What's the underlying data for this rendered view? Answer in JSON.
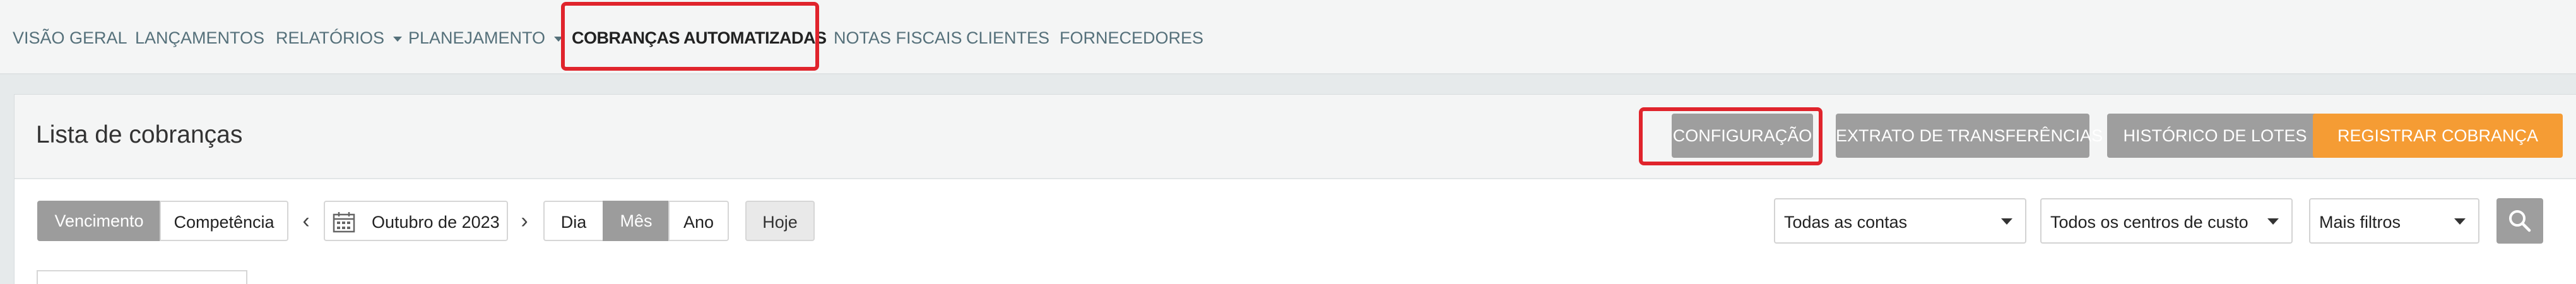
{
  "nav": {
    "items": [
      {
        "label": "VISÃO GERAL"
      },
      {
        "label": "LANÇAMENTOS"
      },
      {
        "label": "RELATÓRIOS"
      },
      {
        "label": "PLANEJAMENTO"
      },
      {
        "label": "COBRANÇAS AUTOMATIZADAS",
        "active": true
      },
      {
        "label": "NOTAS FISCAIS"
      },
      {
        "label": "CLIENTES"
      },
      {
        "label": "FORNECEDORES"
      }
    ]
  },
  "panel": {
    "title": "Lista de cobranças",
    "buttons": {
      "configuracao": "CONFIGURAÇÃO",
      "extrato": "EXTRATO DE TRANSFERÊNCIAS",
      "historico": "HISTÓRICO DE LOTES",
      "registrar": "REGISTRAR COBRANÇA"
    }
  },
  "toolbar": {
    "date_mode": {
      "vencimento": "Vencimento",
      "competencia": "Competência",
      "selected": "Vencimento"
    },
    "prev": "‹",
    "next": "›",
    "date_value": "Outubro de 2023",
    "period": {
      "dia": "Dia",
      "mes": "Mês",
      "ano": "Ano",
      "selected": "Mês"
    },
    "hoje": "Hoje",
    "filters": {
      "contas": "Todas as contas",
      "centros": "Todos os centros de custo",
      "mais": "Mais filtros"
    }
  },
  "colors": {
    "accent_orange": "#f59c34",
    "button_gray": "#9e9e9e",
    "highlight_red": "#e0242c"
  }
}
